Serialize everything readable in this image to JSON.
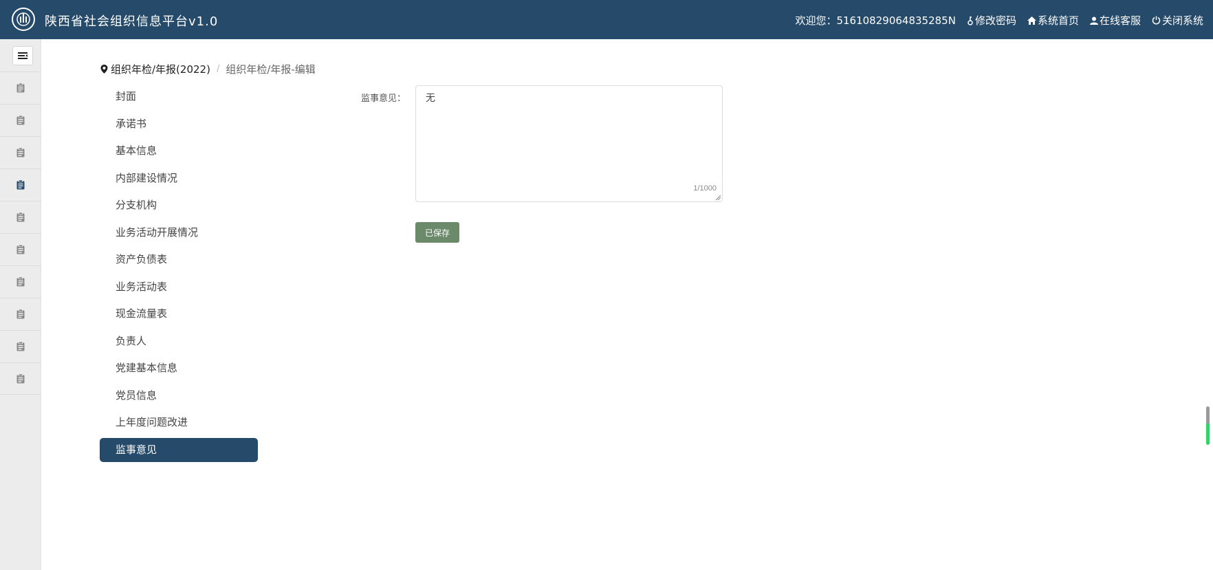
{
  "header": {
    "app_title": "陕西省社会组织信息平台v1.0",
    "welcome_text": "欢迎您：51610829064835285N",
    "nav": [
      {
        "label": "修改密码",
        "icon": "key-icon"
      },
      {
        "label": "系统首页",
        "icon": "home-icon"
      },
      {
        "label": "在线客服",
        "icon": "user-icon"
      },
      {
        "label": "关闭系统",
        "icon": "power-icon"
      }
    ],
    "background_color": "#254a6a"
  },
  "sidebar": {
    "toggle_icon": "menu-toggle-icon",
    "items_count": 10,
    "active_index": 3,
    "icon": "clipboard-icon",
    "active_color": "#254a6a",
    "inactive_color": "#8a8a8a"
  },
  "breadcrumb": {
    "icon": "location-pin-icon",
    "current": "组织年检/年报(2022)",
    "separator": "/",
    "page": "组织年检/年报-编辑"
  },
  "menu": {
    "items": [
      "封面",
      "承诺书",
      "基本信息",
      "内部建设情况",
      "分支机构",
      "业务活动开展情况",
      "资产负债表",
      "业务活动表",
      "现金流量表",
      "负责人",
      "党建基本信息",
      "党员信息",
      "上年度问题改进",
      "监事意见"
    ],
    "active": "监事意见",
    "active_color": "#254a6a"
  },
  "form": {
    "label": "监事意见：",
    "value": "无",
    "counter": "1/1000",
    "save_label": "已保存",
    "save_color": "#6a8a6a"
  }
}
